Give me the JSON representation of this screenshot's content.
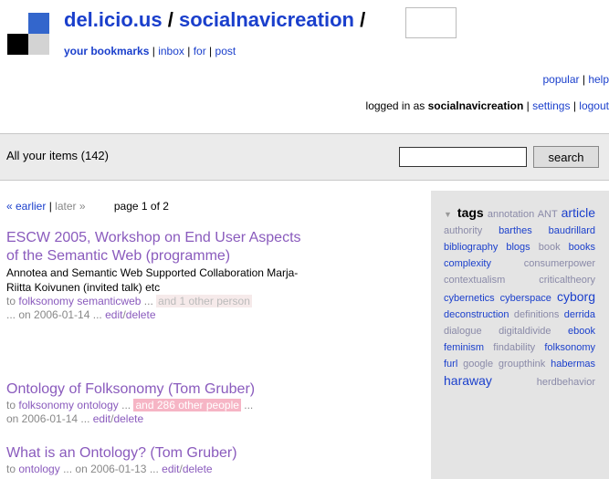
{
  "header": {
    "site": "del.icio.us",
    "user": "socialnavicreation",
    "sep": "/",
    "nav": {
      "bookmarks": "your bookmarks",
      "inbox": "inbox",
      "for": "for",
      "post": "post",
      "pipe": "|"
    }
  },
  "toplinks": {
    "popular": "popular",
    "help": "help",
    "pipe": "|"
  },
  "login": {
    "prefix": "logged in as",
    "user": "socialnavicreation",
    "settings": "settings",
    "logout": "logout",
    "pipe": "|"
  },
  "searchbar": {
    "label": "All your items (142)",
    "button": "search",
    "value": ""
  },
  "pager": {
    "earlier": "« earlier",
    "later": "later »",
    "pipe": "|",
    "page": "page 1 of 2"
  },
  "items": [
    {
      "title": "ESCW 2005, Workshop on End User Aspects of the Semantic Web (programme)",
      "desc": "Annotea and Semantic Web Supported Collaboration Marja-Riitta Koivunen (invited talk) etc",
      "to": "to",
      "tags": [
        "folksonomy",
        "semanticweb"
      ],
      "ellipsis": "...",
      "others": "and 1 other person",
      "on": "... on 2006-01-14 ...",
      "edit": "edit",
      "slash": "/",
      "delete": "delete"
    },
    {
      "title": "Ontology of Folksonomy (Tom Gruber)",
      "to": "to",
      "tags": [
        "folksonomy",
        "ontology"
      ],
      "ellipsis": "...",
      "others": "and 286 other people",
      "trail": "...",
      "on": "on 2006-01-14 ...",
      "edit": "edit",
      "slash": "/",
      "delete": "delete"
    },
    {
      "title": "What is an Ontology? (Tom Gruber)",
      "to": "to",
      "tags": [
        "ontology"
      ],
      "on": "... on 2006-01-13 ...",
      "edit": "edit",
      "slash": "/",
      "delete": "delete"
    }
  ],
  "tags_header": "tags",
  "tags": [
    "annotation",
    "ANT",
    "article",
    "authority",
    "barthes",
    "baudrillard",
    "bibliography",
    "blogs",
    "book",
    "books",
    "complexity",
    "consumerpower",
    "contextualism",
    "criticaltheory",
    "cybernetics",
    "cyberspace",
    "cyborg",
    "deconstruction",
    "definitions",
    "derrida",
    "dialogue",
    "digitaldivide",
    "ebook",
    "feminism",
    "findability",
    "folksonomy",
    "furl",
    "google",
    "groupthink",
    "habermas",
    "haraway",
    "herdbehavior"
  ]
}
